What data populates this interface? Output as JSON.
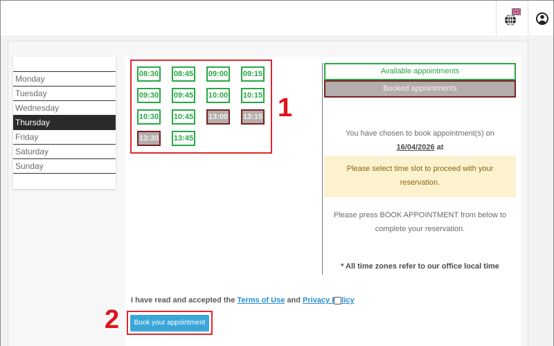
{
  "days": [
    "Monday",
    "Tuesday",
    "Wednesday",
    "Thursday",
    "Friday",
    "Saturday",
    "Sunday"
  ],
  "selected_day": "Thursday",
  "slots": [
    {
      "time": "08:30",
      "status": "available"
    },
    {
      "time": "08:45",
      "status": "available"
    },
    {
      "time": "09:00",
      "status": "available"
    },
    {
      "time": "09:15",
      "status": "available"
    },
    {
      "time": "09:30",
      "status": "available"
    },
    {
      "time": "09:45",
      "status": "available"
    },
    {
      "time": "10:00",
      "status": "available"
    },
    {
      "time": "10:15",
      "status": "available"
    },
    {
      "time": "10:30",
      "status": "available"
    },
    {
      "time": "10:45",
      "status": "available"
    },
    {
      "time": "13:00",
      "status": "booked"
    },
    {
      "time": "13:15",
      "status": "booked"
    },
    {
      "time": "13:30",
      "status": "booked"
    },
    {
      "time": "13:45",
      "status": "available"
    }
  ],
  "callouts": {
    "one": "1",
    "two": "2"
  },
  "legend": {
    "available": "Available appointments",
    "booked": "Booked appointments"
  },
  "info": {
    "chosen_prefix": "You have chosen to book appointment(s) on",
    "date": "16/04/2026",
    "date_suffix": " at",
    "notice": "Please select time slot to proceed with your reservation.",
    "press_text": "Please press BOOK APPOINTMENT from below to complete your reservation.",
    "timezone_note": "* All time zones refer to our office local time"
  },
  "terms": {
    "prefix": "I have read and accepted the ",
    "terms_link": "Terms of Use",
    "and": " and ",
    "privacy_link": "Privacy Policy"
  },
  "book_button": "Book your appointment",
  "icons": {
    "language": "globe-icon",
    "account": "user-icon"
  },
  "colors": {
    "available": "#27a844",
    "booked": "#b5acac",
    "highlight": "#e0262b",
    "button": "#3aa6d8"
  }
}
